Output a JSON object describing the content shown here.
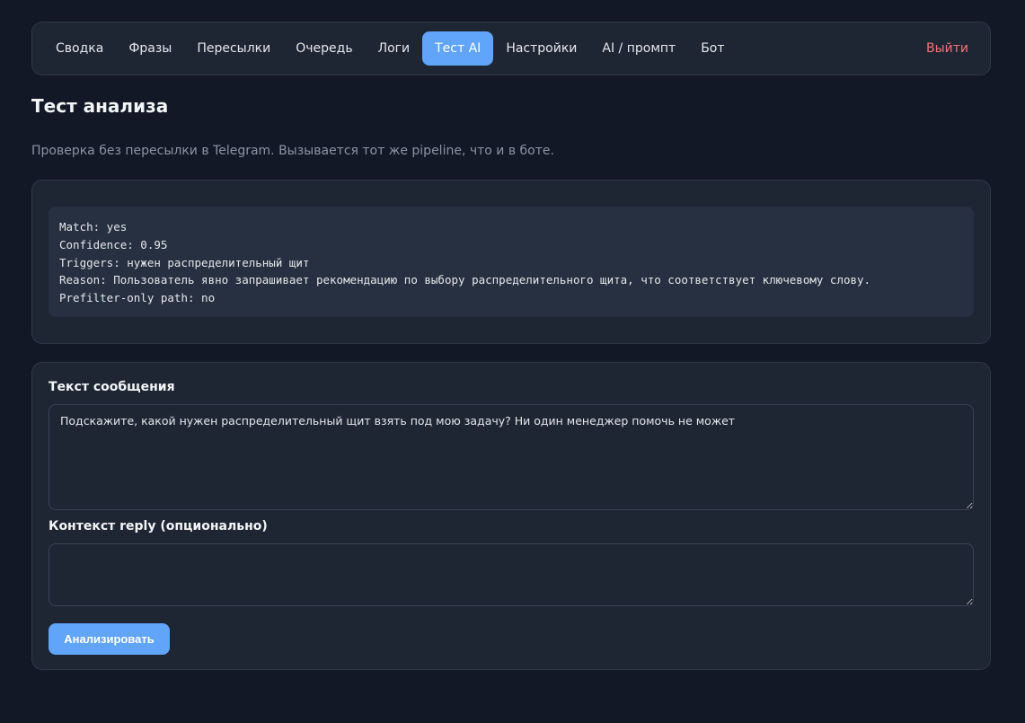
{
  "nav": {
    "items": [
      {
        "label": "Сводка"
      },
      {
        "label": "Фразы"
      },
      {
        "label": "Пересылки"
      },
      {
        "label": "Очередь"
      },
      {
        "label": "Логи"
      },
      {
        "label": "Тест AI",
        "active": true
      },
      {
        "label": "Настройки"
      },
      {
        "label": "AI / промпт"
      },
      {
        "label": "Бот"
      }
    ],
    "logout_label": "Выйти"
  },
  "page": {
    "title": "Тест анализа",
    "subtitle": "Проверка без пересылки в Telegram. Вызывается тот же pipeline, что и в боте."
  },
  "result": {
    "lines": [
      "Match: yes",
      "Confidence: 0.95",
      "Triggers: нужен распределительный щит",
      "Reason: Пользователь явно запрашивает рекомендацию по выбору распределительного щита, что соответствует ключевому слову.",
      "Prefilter-only path: no"
    ]
  },
  "form": {
    "message_label": "Текст сообщения",
    "message_value": "Подскажите, какой нужен распределительный щит взять под мою задачу? Ни один менеджер помочь не может",
    "context_label": "Контекст reply (опционально)",
    "context_value": "",
    "submit_label": "Анализировать"
  },
  "colors": {
    "background": "#121826",
    "card": "#1e2634",
    "accent": "#60a5fa",
    "logout": "#f87171"
  }
}
